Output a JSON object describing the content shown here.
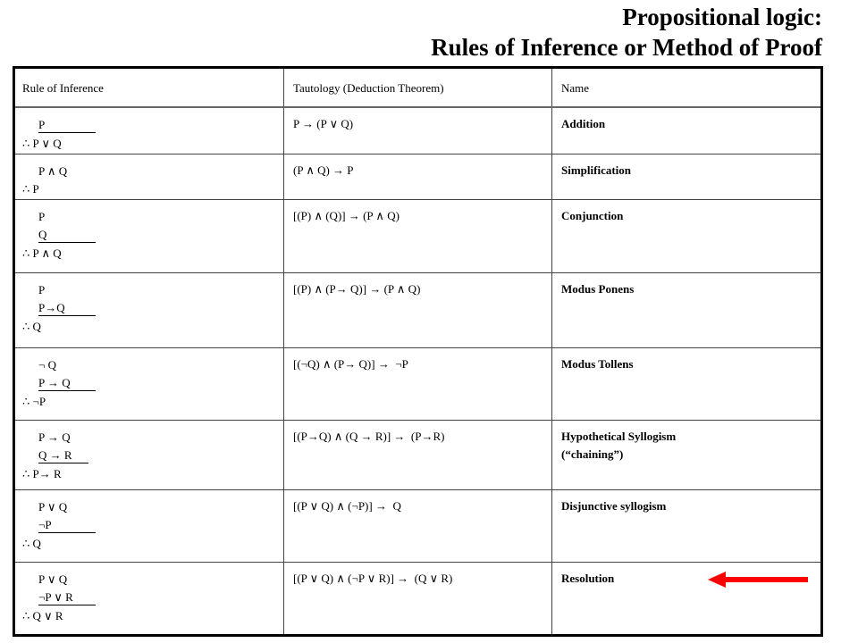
{
  "title": {
    "line1": "Propositional logic:",
    "line2": "Rules of Inference or Method of Proof"
  },
  "table": {
    "headers": [
      "Rule of Inference",
      "Tautology (Deduction Theorem)",
      "Name"
    ],
    "rows": [
      {
        "premises": [
          "P"
        ],
        "conclusion": "∴ P ∨ Q",
        "tautology": "P → (P ∨ Q)",
        "name": "Addition",
        "name2": ""
      },
      {
        "premises": [
          "P ∧ Q"
        ],
        "conclusion": "∴ P",
        "tautology": "(P ∧ Q) → P",
        "name": "Simplification",
        "name2": ""
      },
      {
        "premises": [
          "P",
          "Q"
        ],
        "conclusion": "∴ P ∧ Q",
        "tautology": "[(P) ∧ (Q)] → (P ∧ Q)",
        "name": "Conjunction",
        "name2": ""
      },
      {
        "premises": [
          "P",
          "P→Q"
        ],
        "conclusion": "∴ Q",
        "tautology": "[(P) ∧ (P→ Q)] → (P ∧ Q)",
        "name": "Modus Ponens",
        "name2": ""
      },
      {
        "premises": [
          "¬ Q",
          "P → Q"
        ],
        "conclusion": "∴ ¬P",
        "tautology": "[(¬Q) ∧ (P→ Q)] →  ¬P",
        "name": "Modus Tollens",
        "name2": ""
      },
      {
        "premises": [
          "P → Q",
          "Q → R"
        ],
        "conclusion": "∴ P→ R",
        "tautology": "[(P→Q) ∧ (Q → R)] →  (P→R)",
        "name": "Hypothetical Syllogism",
        "name2": "(“chaining”)"
      },
      {
        "premises": [
          "P ∨ Q",
          "¬P"
        ],
        "conclusion": "∴ Q",
        "tautology": "[(P ∨ Q) ∧ (¬P)] →  Q",
        "name": "Disjunctive syllogism",
        "name2": ""
      },
      {
        "premises": [
          "P ∨ Q",
          "¬P ∨ R"
        ],
        "conclusion": "∴ Q ∨ R",
        "tautology": "[(P ∨ Q) ∧ (¬P ∨ R)] →  (Q ∨ R)",
        "name": "Resolution",
        "name2": ""
      }
    ]
  },
  "highlight": {
    "arrow_color": "#ff0000",
    "target_row": "Resolution"
  }
}
